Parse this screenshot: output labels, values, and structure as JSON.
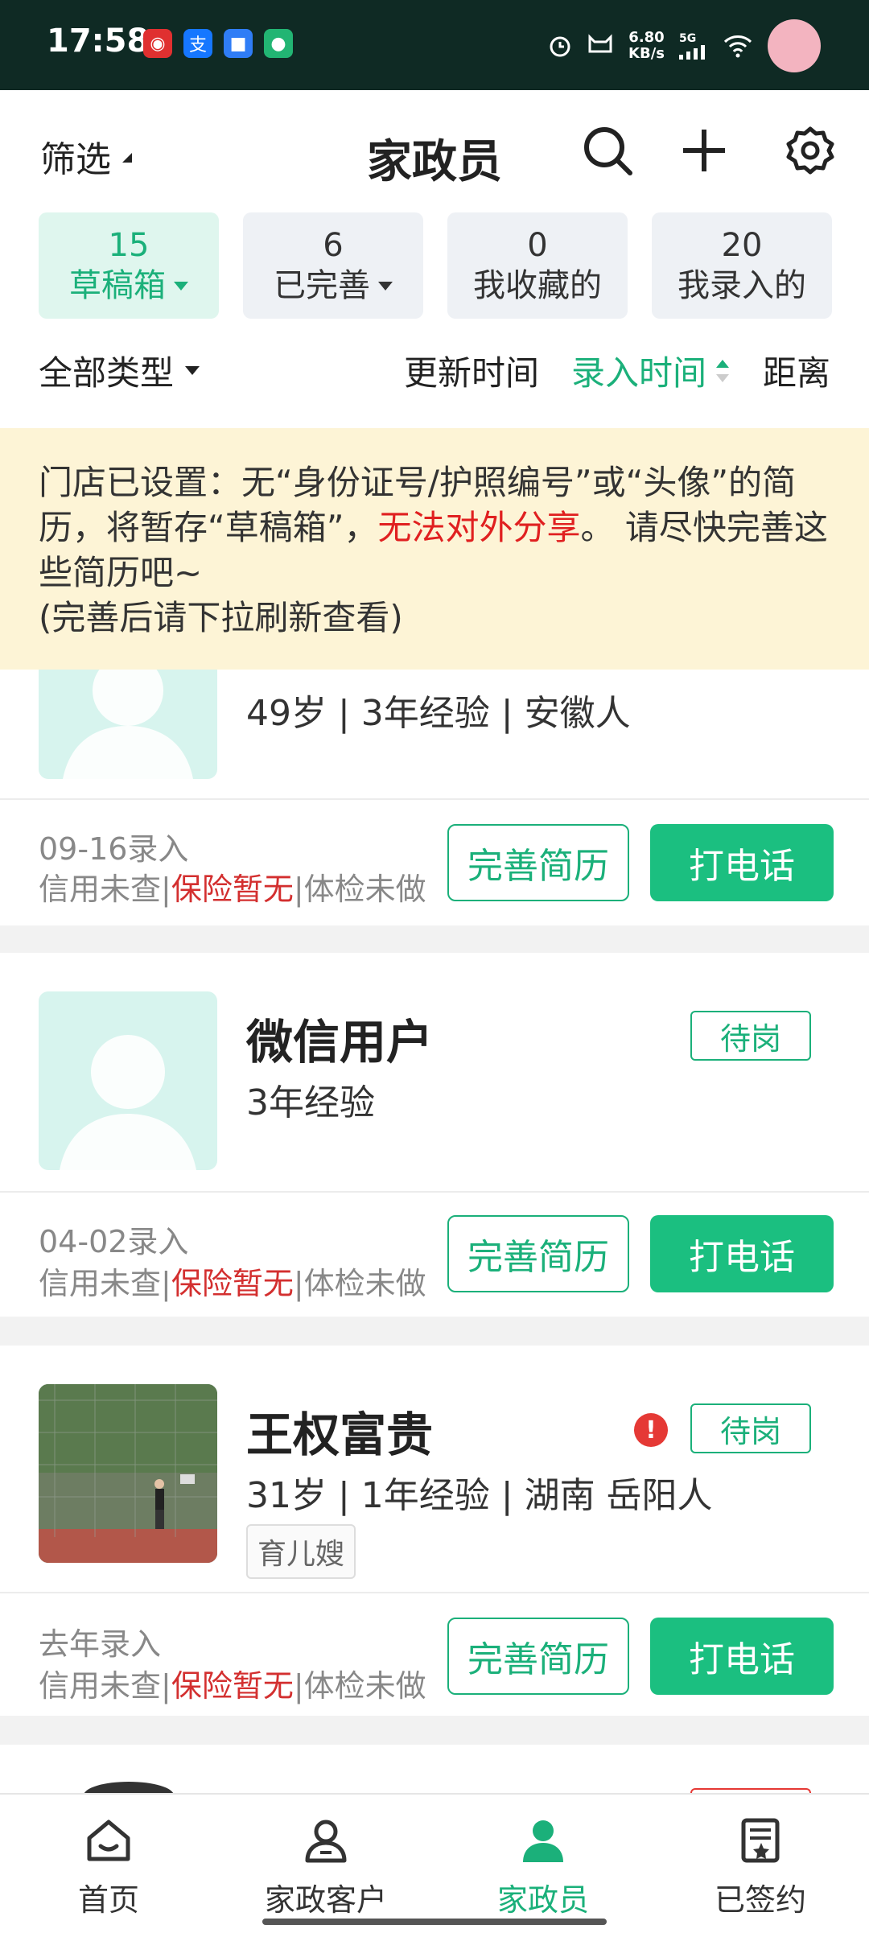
{
  "status_bar": {
    "time": "17:58",
    "net_speed_value": "6.80",
    "net_speed_unit": "KB/s",
    "net_type": "5G",
    "app_icons": [
      "netease-icon",
      "alipay-icon",
      "cloud-icon",
      "panda-icon"
    ]
  },
  "header": {
    "filter_label": "筛选",
    "title": "家政员",
    "icons": [
      "search-icon",
      "plus-icon",
      "gear-icon"
    ]
  },
  "tabs": [
    {
      "count": "15",
      "label": "草稿箱",
      "active": true,
      "dropdown": true
    },
    {
      "count": "6",
      "label": "已完善",
      "active": false,
      "dropdown": true
    },
    {
      "count": "0",
      "label": "我收藏的",
      "active": false,
      "dropdown": false
    },
    {
      "count": "20",
      "label": "我录入的",
      "active": false,
      "dropdown": false
    }
  ],
  "sort": {
    "type_label": "全部类型",
    "options": [
      "更新时间",
      "录入时间",
      "距离"
    ],
    "active": "录入时间"
  },
  "notice": {
    "part1": "门店已设置：无“身份证号/护照编号”或“头像”的简历，将暂存“草稿箱”，",
    "part2_red": "无法对外分享",
    "part3": "。 请尽快完善这些简历吧~",
    "part4": "(完善后请下拉刷新查看)"
  },
  "cards": [
    {
      "name": "",
      "info": "49岁  |  3年经验  |  安徽人",
      "entry_date": "09-16录入",
      "credit": "信用未查",
      "insurance": "保险暂无",
      "checkup": "体检未做",
      "status_tag": "",
      "complete_label": "完善简历",
      "call_label": "打电话"
    },
    {
      "name": "微信用户",
      "info": "3年经验",
      "entry_date": "04-02录入",
      "credit": "信用未查",
      "insurance": "保险暂无",
      "checkup": "体检未做",
      "status_tag": "待岗",
      "complete_label": "完善简历",
      "call_label": "打电话"
    },
    {
      "name": "王权富贵",
      "info": "31岁  |  1年经验  |  湖南 岳阳人",
      "skill": "育儿嫂",
      "warning": "!",
      "entry_date": "去年录入",
      "credit": "信用未查",
      "insurance": "保险暂无",
      "checkup": "体检未做",
      "status_tag": "待岗",
      "complete_label": "完善简历",
      "call_label": "打电话"
    }
  ],
  "bottom_nav": [
    {
      "label": "首页",
      "icon": "home-icon",
      "active": false
    },
    {
      "label": "家政客户",
      "icon": "client-icon",
      "active": false
    },
    {
      "label": "家政员",
      "icon": "worker-icon",
      "active": true
    },
    {
      "label": "已签约",
      "icon": "contract-icon",
      "active": false
    }
  ],
  "colors": {
    "accent": "#1bb07a",
    "notice_bg": "#fdf4d6",
    "warning_red": "#e02020",
    "status_bar_bg": "#0f2a24"
  }
}
